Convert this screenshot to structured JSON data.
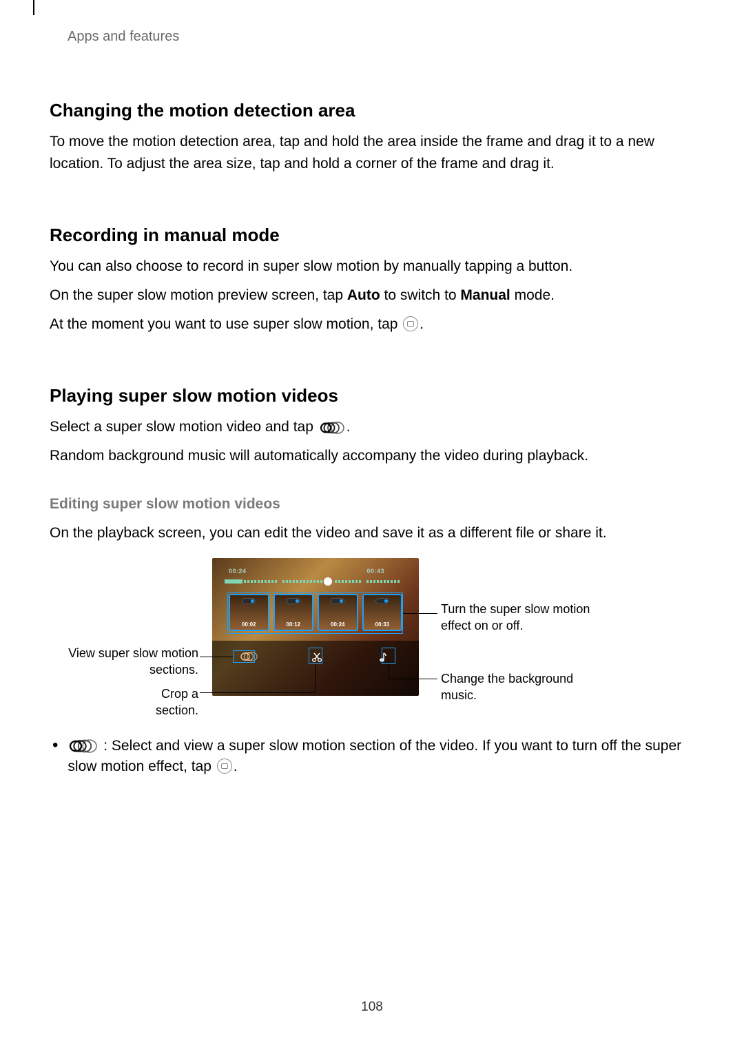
{
  "header": {
    "section": "Apps and features"
  },
  "h_motion": "Changing the motion detection area",
  "p_motion": "To move the motion detection area, tap and hold the area inside the frame and drag it to a new location. To adjust the area size, tap and hold a corner of the frame and drag it.",
  "h_manual": "Recording in manual mode",
  "p_manual_1": "You can also choose to record in super slow motion by manually tapping a button.",
  "p_manual_2a": "On the super slow motion preview screen, tap ",
  "p_manual_2_bold1": "Auto",
  "p_manual_2b": " to switch to ",
  "p_manual_2_bold2": "Manual",
  "p_manual_2c": " mode.",
  "p_manual_3a": "At the moment you want to use super slow motion, tap ",
  "p_manual_3b": ".",
  "h_play": "Playing super slow motion videos",
  "p_play_1a": "Select a super slow motion video and tap ",
  "p_play_1b": ".",
  "p_play_2": "Random background music will automatically accompany the video during playback.",
  "sub_edit": "Editing super slow motion videos",
  "p_edit": "On the playback screen, you can edit the video and save it as a different file or share it.",
  "fig": {
    "ts_left": "00:24",
    "ts_right": "00:43",
    "thumbs": [
      "00:02",
      "00:12",
      "00:24",
      "00:33"
    ],
    "call_toggle": "Turn the super slow motion effect on or off.",
    "call_view": "View super slow motion sections.",
    "call_crop": "Crop a section.",
    "call_music": "Change the background music."
  },
  "bullet1a": " : Select and view a super slow motion section of the video. If you want to turn off the super slow motion effect, tap ",
  "bullet1b": ".",
  "page_number": "108"
}
